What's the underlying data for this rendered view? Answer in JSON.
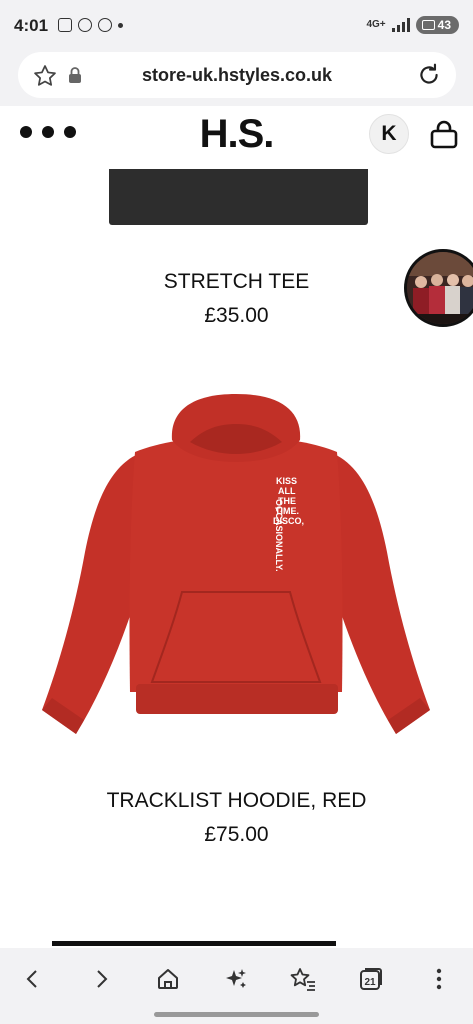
{
  "status_bar": {
    "time": "4:01",
    "network": "4G+",
    "battery": "43"
  },
  "browser": {
    "url": "store-uk.hstyles.co.uk",
    "tab_count": "21"
  },
  "site": {
    "logo": "H.S.",
    "account_initial": "K"
  },
  "products": [
    {
      "title": "STRETCH TEE",
      "price": "£35.00",
      "color": "#2d2d2d"
    },
    {
      "title": "TRACKLIST HOODIE, RED",
      "price": "£75.00",
      "color": "#c8332a"
    }
  ],
  "hoodie_print": [
    "KISS",
    "ALL",
    "THE",
    "TIME.",
    "DISCO,",
    "OCCASIONALLY."
  ],
  "icons": {
    "back": "chevron-left-icon",
    "forward": "chevron-right-icon",
    "home": "home-icon",
    "ai": "sparkles-icon",
    "bookmarks": "star-list-icon",
    "tabs": "tabs-icon",
    "more": "more-vertical-icon"
  }
}
